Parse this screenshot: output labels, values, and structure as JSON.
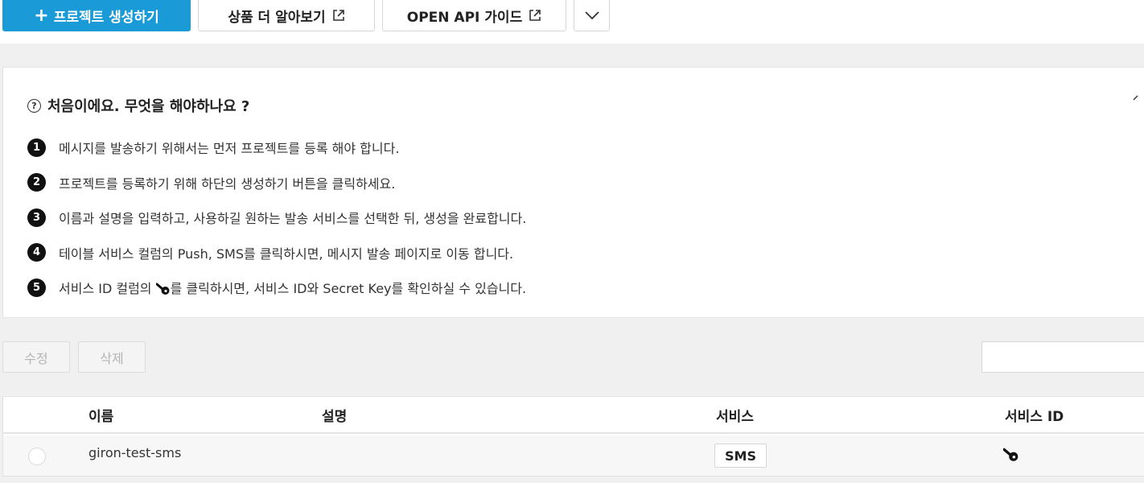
{
  "toolbar": {
    "create_label": "프로젝트 생성하기",
    "product_label": "상품 더 알아보기",
    "api_label": "OPEN API 가이드"
  },
  "info": {
    "title": "처음이에요. 무엇을 해야하나요 ?",
    "steps": [
      {
        "num": "1",
        "text": "메시지를 발송하기 위해서는 먼저 프로젝트를 등록 해야 합니다."
      },
      {
        "num": "2",
        "text": "프로젝트를 등록하기 위해 하단의 생성하기 버튼을 클릭하세요."
      },
      {
        "num": "3",
        "text": "이름과 설명을 입력하고, 사용하길 원하는 발송 서비스를 선택한 뒤, 생성을 완료합니다."
      },
      {
        "num": "4",
        "text": "테이블 서비스 컬럼의 Push, SMS를 클릭하시면, 메시지 발송 페이지로 이동 합니다."
      },
      {
        "num": "5",
        "text_before": "서비스 ID 컬럼의",
        "text_after": "를 클릭하시면, 서비스 ID와 Secret Key를 확인하실 수 있습니다."
      }
    ]
  },
  "actions": {
    "edit_label": "수정",
    "delete_label": "삭제",
    "search_value": ""
  },
  "table": {
    "columns": [
      "이름",
      "설명",
      "서비스",
      "서비스 ID"
    ],
    "rows": [
      {
        "name": "giron-test-sms",
        "description": "",
        "service": "SMS",
        "service_id_icon": "key-icon"
      }
    ]
  },
  "colors": {
    "primary": "#1a9ad6",
    "background": "#f0f0f0"
  }
}
